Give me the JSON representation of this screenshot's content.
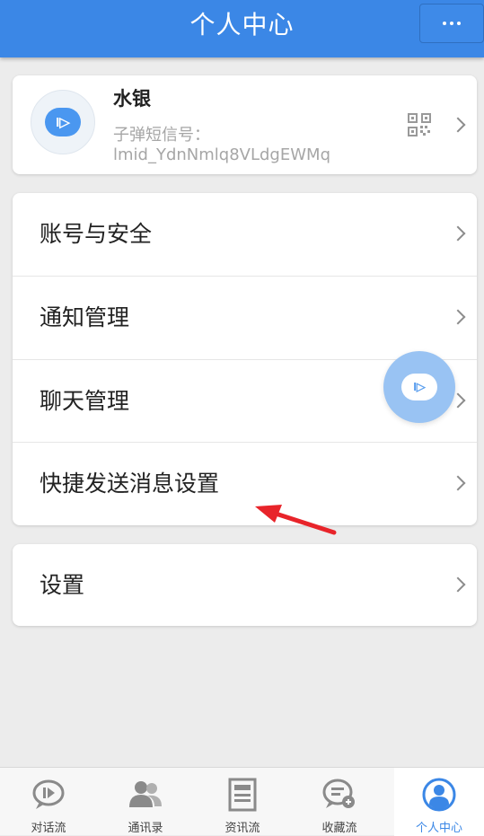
{
  "header": {
    "title": "个人中心",
    "more_icon": "more-dots-icon"
  },
  "profile": {
    "name": "水银",
    "bullet_label": "子弹短信号：",
    "bullet_id": "lmid_YdnNmlq8VLdgEWMq",
    "avatar_icon": "chat-bubble-logo-icon",
    "qr_icon": "qr-code-icon"
  },
  "menu": {
    "items": [
      {
        "label": "账号与安全"
      },
      {
        "label": "通知管理"
      },
      {
        "label": "聊天管理"
      },
      {
        "label": "快捷发送消息设置"
      }
    ]
  },
  "settings": {
    "label": "设置"
  },
  "tabs": [
    {
      "label": "对话流",
      "icon": "chat-bubble-icon",
      "active": false
    },
    {
      "label": "通讯录",
      "icon": "contacts-icon",
      "active": false
    },
    {
      "label": "资讯流",
      "icon": "news-icon",
      "active": false
    },
    {
      "label": "收藏流",
      "icon": "favorites-icon",
      "active": false
    },
    {
      "label": "个人中心",
      "icon": "profile-icon",
      "active": true
    }
  ],
  "colors": {
    "accent": "#3b87e6",
    "background": "#ececec",
    "annotation_arrow": "#e8242a"
  }
}
